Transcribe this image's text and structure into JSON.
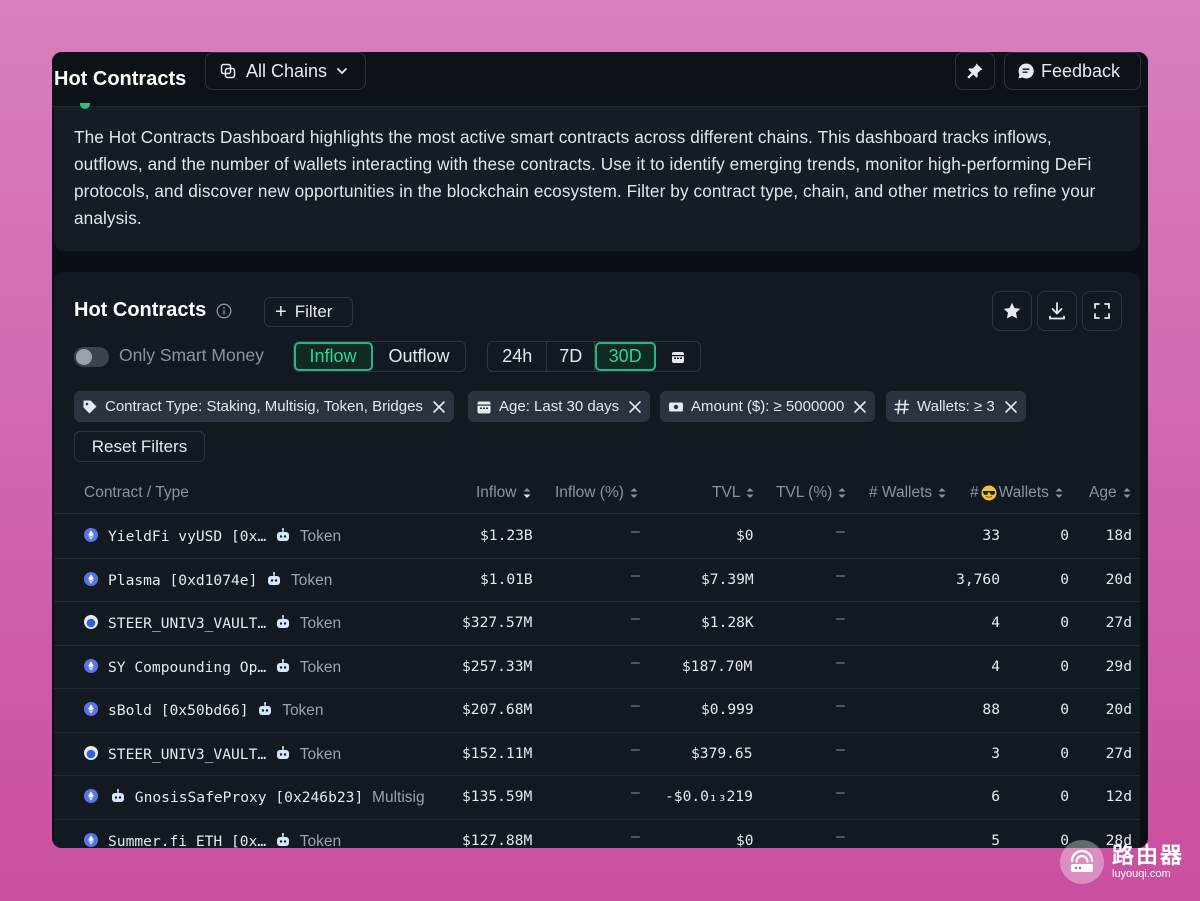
{
  "app": {
    "title": "Hot Contracts"
  },
  "chain_selector": {
    "label": "All Chains"
  },
  "feedback": {
    "label": "Feedback"
  },
  "description": "The Hot Contracts Dashboard highlights the most active smart contracts across different chains. This dashboard tracks inflows, outflows, and the number of wallets interacting with these contracts. Use it to identify emerging trends, monitor high-performing DeFi protocols, and discover new opportunities in the blockchain ecosystem. Filter by contract type, chain, and other metrics to refine your analysis.",
  "panel": {
    "title": "Hot Contracts",
    "filter_label": "Filter",
    "smart_money_label": "Only Smart Money",
    "smart_money_on": false,
    "flow_options": [
      "Inflow",
      "Outflow"
    ],
    "flow_selected": "Inflow",
    "period_options": [
      "24h",
      "7D",
      "30D"
    ],
    "period_selected": "30D",
    "reset_label": "Reset Filters"
  },
  "chips": [
    {
      "icon": "tag-icon",
      "label": "Contract Type: Staking, Multisig, Token, Bridges"
    },
    {
      "icon": "calendar-icon",
      "label": "Age: Last 30 days"
    },
    {
      "icon": "money-icon",
      "label": "Amount ($): ≥ 5000000"
    },
    {
      "icon": "hash-icon",
      "label": "Wallets: ≥ 3"
    }
  ],
  "columns": {
    "contract": "Contract / Type",
    "inflow": "Inflow",
    "inflow_pct": "Inflow (%)",
    "tvl": "TVL",
    "tvl_pct": "TVL (%)",
    "wallets": "# Wallets",
    "smart_wallets": "Wallets",
    "age": "Age"
  },
  "rows": [
    {
      "chain": "ethereum",
      "name": "YieldFi vyUSD [0x…",
      "type": "Token",
      "inflow": "$1.23B",
      "inflow_pct": "—",
      "tvl": "$0",
      "tvl_pct": "—",
      "wallets": "33",
      "smart_wallets": "0",
      "age": "18d"
    },
    {
      "chain": "ethereum",
      "name": "Plasma [0xd1074e]",
      "type": "Token",
      "inflow": "$1.01B",
      "inflow_pct": "—",
      "tvl": "$7.39M",
      "tvl_pct": "—",
      "wallets": "3,760",
      "smart_wallets": "0",
      "age": "20d"
    },
    {
      "chain": "base",
      "name": "STEER_UNIV3_VAULT…",
      "type": "Token",
      "inflow": "$327.57M",
      "inflow_pct": "—",
      "tvl": "$1.28K",
      "tvl_pct": "—",
      "wallets": "4",
      "smart_wallets": "0",
      "age": "27d"
    },
    {
      "chain": "ethereum",
      "name": "SY Compounding Op…",
      "type": "Token",
      "inflow": "$257.33M",
      "inflow_pct": "—",
      "tvl": "$187.70M",
      "tvl_pct": "—",
      "wallets": "4",
      "smart_wallets": "0",
      "age": "29d"
    },
    {
      "chain": "ethereum",
      "name": "sBold [0x50bd66]",
      "type": "Token",
      "inflow": "$207.68M",
      "inflow_pct": "—",
      "tvl": "$0.999",
      "tvl_pct": "—",
      "wallets": "88",
      "smart_wallets": "0",
      "age": "20d"
    },
    {
      "chain": "base",
      "name": "STEER_UNIV3_VAULT…",
      "type": "Token",
      "inflow": "$152.11M",
      "inflow_pct": "—",
      "tvl": "$379.65",
      "tvl_pct": "—",
      "wallets": "3",
      "smart_wallets": "0",
      "age": "27d"
    },
    {
      "chain": "ethereum",
      "name": "GnosisSafeProxy [0x246b23]",
      "type": "Multisig",
      "inflow": "$135.59M",
      "inflow_pct": "—",
      "tvl": "-$0.0₁₃219",
      "tvl_pct": "—",
      "wallets": "6",
      "smart_wallets": "0",
      "age": "12d"
    },
    {
      "chain": "ethereum",
      "name": "Summer.fi ETH [0x…",
      "type": "Token",
      "inflow": "$127.88M",
      "inflow_pct": "—",
      "tvl": "$0",
      "tvl_pct": "—",
      "wallets": "5",
      "smart_wallets": "0",
      "age": "28d"
    }
  ],
  "watermark": {
    "name": "路由器",
    "site": "luyouqi.com"
  },
  "colors": {
    "accent": "#2ed69a",
    "background": "#0a0f15",
    "card": "#121921",
    "chip": "#2a333e"
  }
}
